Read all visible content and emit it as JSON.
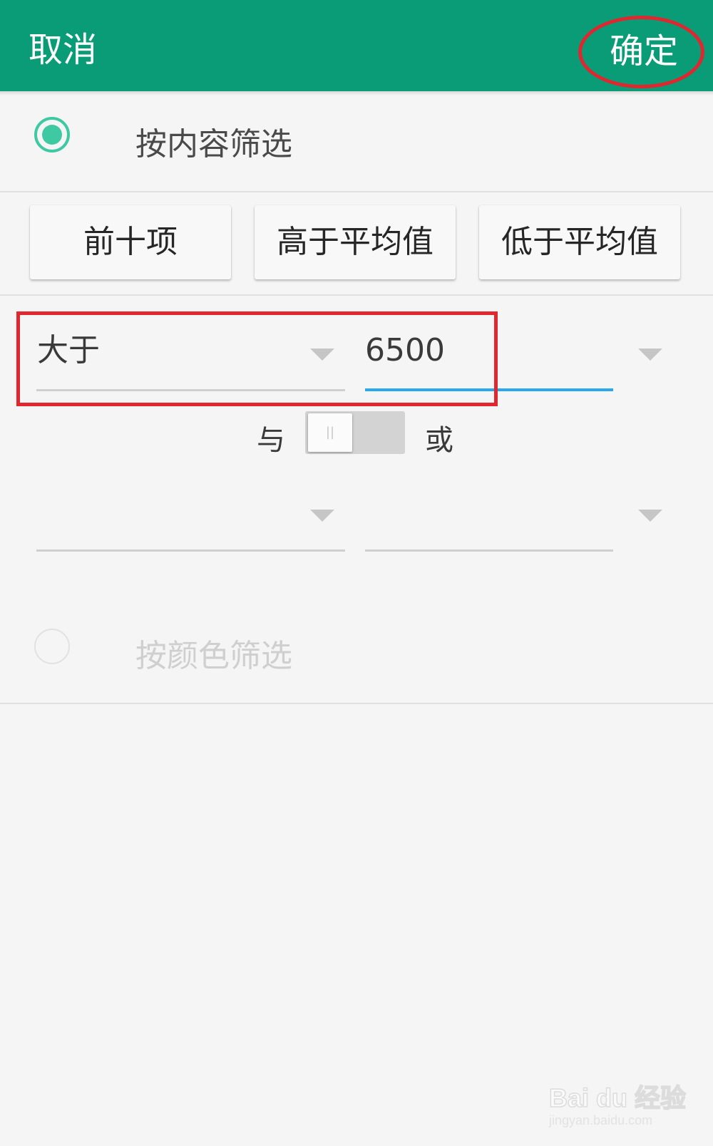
{
  "header": {
    "cancel_label": "取消",
    "confirm_label": "确定",
    "background_color": "#0a9c76"
  },
  "filter_by_content": {
    "label": "按内容筛选",
    "selected": true
  },
  "quick_filters": [
    "前十项",
    "高于平均值",
    "低于平均值"
  ],
  "condition1": {
    "operator": "大于",
    "value": "6500"
  },
  "logic": {
    "and_label": "与",
    "or_label": "或",
    "selected": "与"
  },
  "condition2": {
    "operator": "",
    "value": ""
  },
  "filter_by_color": {
    "label": "按颜色筛选",
    "selected": false
  },
  "watermark": {
    "brand": "Bai du 经验",
    "url": "jingyan.baidu.com"
  },
  "accent_colors": {
    "radio": "#3fc9a3",
    "active_underline": "#29a8ee",
    "annotation": "#e0262f"
  }
}
